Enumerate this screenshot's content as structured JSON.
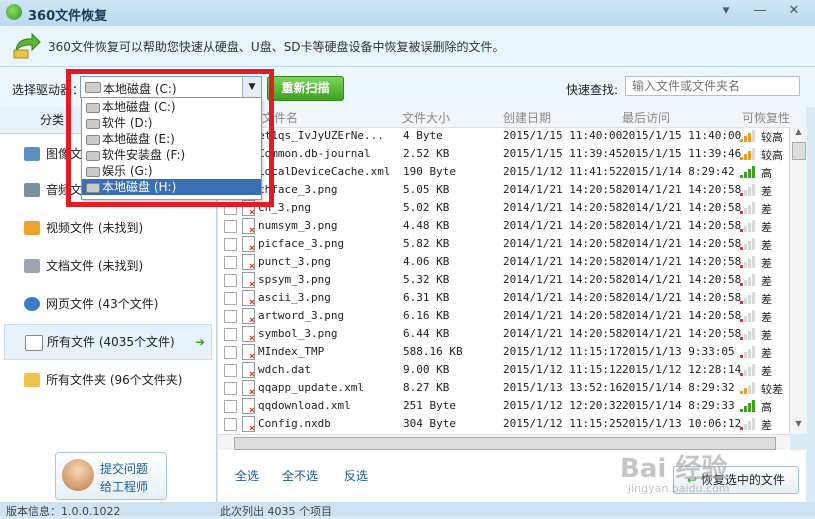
{
  "window": {
    "title": "360文件恢复",
    "controls": [
      "▾",
      "—",
      "✕"
    ]
  },
  "info": {
    "text": "360文件恢复可以帮助您快速从硬盘、U盘、SD卡等硬盘设备中恢复被误删除的文件。"
  },
  "toolbar": {
    "drive_label": "选择驱动器：",
    "selected_drive": "本地磁盘 (C:)",
    "rescan_label": "重新扫描",
    "search_label": "快速查找:",
    "search_placeholder": "输入文件或文件夹名"
  },
  "dropdown": {
    "options": [
      "本地磁盘 (C:)",
      "软件 (D:)",
      "本地磁盘 (E:)",
      "软件安装盘 (F:)",
      "娱乐 (G:)",
      "本地磁盘 (H:)"
    ],
    "highlighted_index": 5
  },
  "sidebar": {
    "header": "分类",
    "items": [
      {
        "label": "图像文件",
        "icon": "image-icon"
      },
      {
        "label": "音频文件",
        "icon": "music-icon"
      },
      {
        "label": "视频文件 (未找到)",
        "icon": "video-icon"
      },
      {
        "label": "文档文件 (未找到)",
        "icon": "document-icon"
      },
      {
        "label": "网页文件 (43个文件)",
        "icon": "globe-icon"
      },
      {
        "label": "所有文件 (4035个文件)",
        "icon": "file-icon",
        "selected": true
      },
      {
        "label": "所有文件夹 (96个文件夹)",
        "icon": "folder-icon"
      }
    ],
    "report_line1": "提交问题",
    "report_line2": "给工程师"
  },
  "table": {
    "columns": [
      "文件名",
      "文件大小",
      "创建日期",
      "最后访问",
      "可恢复性"
    ],
    "rows": [
      {
        "name": "et1qs_IvJyUZErNe...",
        "size": "4 Byte",
        "created": "2015/1/15 11:40:00",
        "accessed": "2015/1/15 11:40:00",
        "quality": "较高",
        "level": 4
      },
      {
        "name": "Common.db-journal",
        "size": "2.52 KB",
        "created": "2015/1/15 11:39:45",
        "accessed": "2015/1/15 11:39:46",
        "quality": "较高",
        "level": 4
      },
      {
        "name": "LocalDeviceCache.xml",
        "size": "190 Byte",
        "created": "2015/1/12 11:41:52",
        "accessed": "2015/1/14 8:29:42",
        "quality": "高",
        "level": 5
      },
      {
        "name": "chface_3.png",
        "size": "5.05 KB",
        "created": "2014/1/21 14:20:58",
        "accessed": "2014/1/21 14:20:58",
        "quality": "差",
        "level": 1
      },
      {
        "name": "ch_3.png",
        "size": "5.02 KB",
        "created": "2014/1/21 14:20:58",
        "accessed": "2014/1/21 14:20:58",
        "quality": "差",
        "level": 1
      },
      {
        "name": "numsym_3.png",
        "size": "4.48 KB",
        "created": "2014/1/21 14:20:58",
        "accessed": "2014/1/21 14:20:58",
        "quality": "差",
        "level": 1
      },
      {
        "name": "picface_3.png",
        "size": "5.82 KB",
        "created": "2014/1/21 14:20:58",
        "accessed": "2014/1/21 14:20:58",
        "quality": "差",
        "level": 1
      },
      {
        "name": "punct_3.png",
        "size": "4.06 KB",
        "created": "2014/1/21 14:20:58",
        "accessed": "2014/1/21 14:20:58",
        "quality": "差",
        "level": 1
      },
      {
        "name": "spsym_3.png",
        "size": "5.32 KB",
        "created": "2014/1/21 14:20:58",
        "accessed": "2014/1/21 14:20:58",
        "quality": "差",
        "level": 1
      },
      {
        "name": "ascii_3.png",
        "size": "6.31 KB",
        "created": "2014/1/21 14:20:58",
        "accessed": "2014/1/21 14:20:58",
        "quality": "差",
        "level": 1
      },
      {
        "name": "artword_3.png",
        "size": "6.16 KB",
        "created": "2014/1/21 14:20:58",
        "accessed": "2014/1/21 14:20:58",
        "quality": "差",
        "level": 1
      },
      {
        "name": "symbol_3.png",
        "size": "6.44 KB",
        "created": "2014/1/21 14:20:58",
        "accessed": "2014/1/21 14:20:58",
        "quality": "差",
        "level": 1
      },
      {
        "name": "MIndex_TMP",
        "size": "588.16 KB",
        "created": "2015/1/12 11:15:17",
        "accessed": "2015/1/13 9:33:05",
        "quality": "差",
        "level": 1
      },
      {
        "name": "wdch.dat",
        "size": "9.00 KB",
        "created": "2015/1/12 11:15:12",
        "accessed": "2015/1/12 12:28:14",
        "quality": "差",
        "level": 1
      },
      {
        "name": "qqapp_update.xml",
        "size": "8.27 KB",
        "created": "2015/1/13 13:52:16",
        "accessed": "2015/1/14 8:29:32",
        "quality": "较差",
        "level": 2
      },
      {
        "name": "qqdownload.xml",
        "size": "251 Byte",
        "created": "2015/1/12 12:20:32",
        "accessed": "2015/1/14 8:29:33",
        "quality": "高",
        "level": 5
      },
      {
        "name": "Config.nxdb",
        "size": "304 Byte",
        "created": "2015/1/12 11:15:25",
        "accessed": "2015/1/13 10:06:12",
        "quality": "差",
        "level": 1
      }
    ]
  },
  "actions": {
    "select_all": "全选",
    "select_none": "全不选",
    "invert": "反选",
    "restore": "恢复选中的文件"
  },
  "watermark": {
    "brand": "Bai 经验",
    "url": "jingyan.baidu.com"
  },
  "status": {
    "version": "版本信息：1.0.0.1022",
    "listed": "此次列出 4035 个项目"
  },
  "colors": {
    "accent_green": "#3ba21f",
    "highlight_blue": "#3a6fb3",
    "annotation_red": "#e51b23"
  }
}
